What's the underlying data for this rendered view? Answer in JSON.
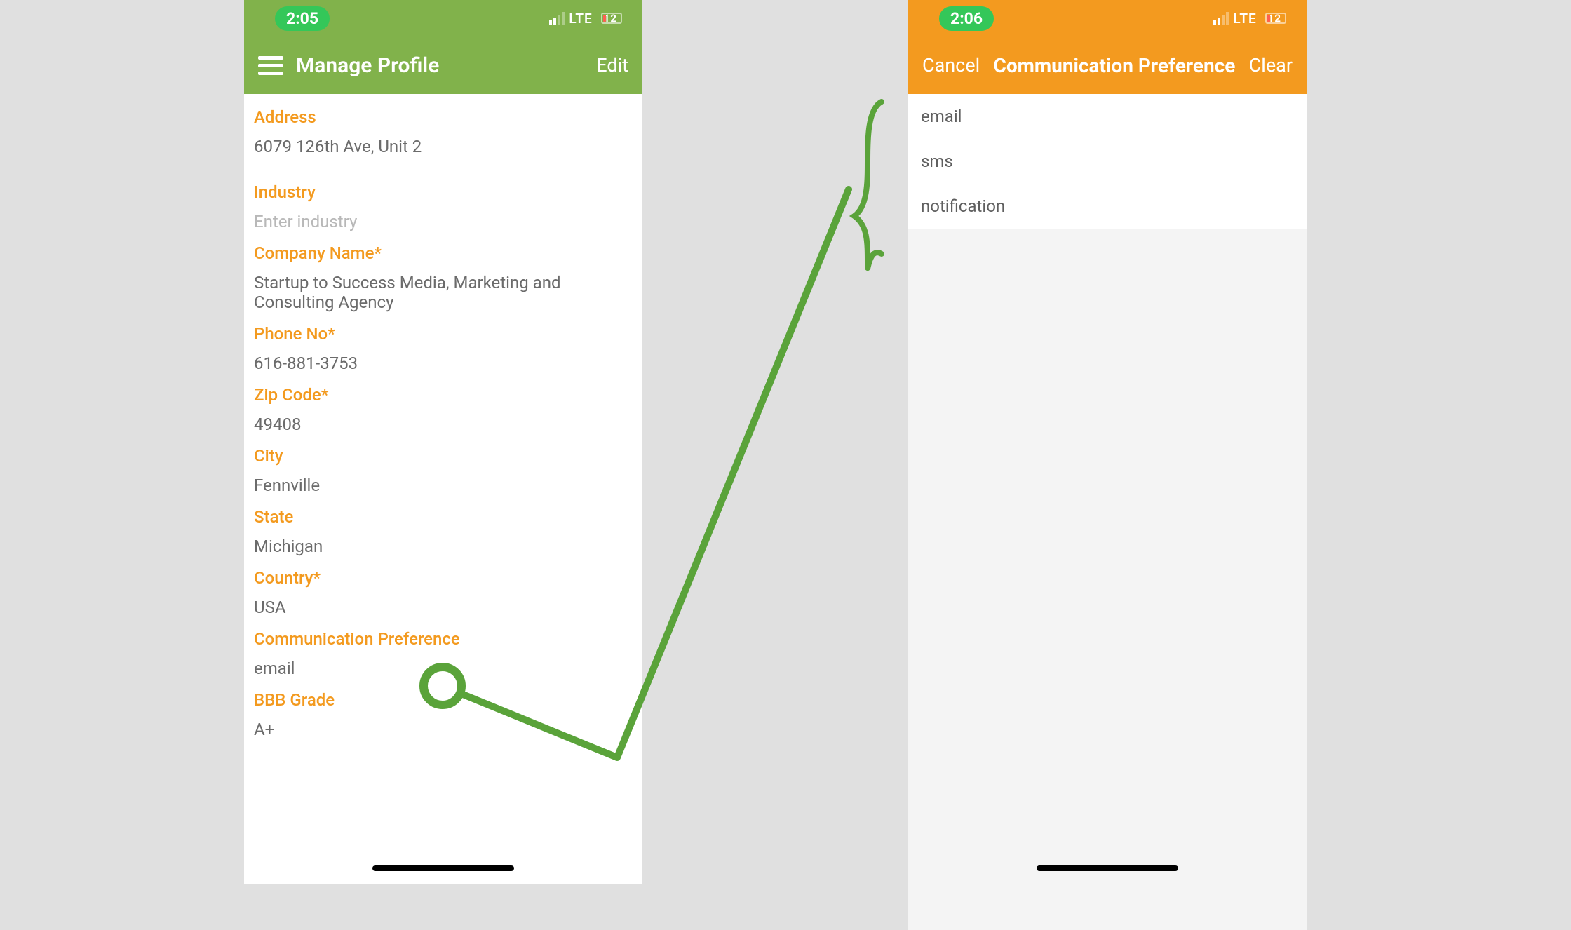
{
  "colors": {
    "green": "#81b24b",
    "orange": "#f39a1f",
    "annotation": "#5aa33a"
  },
  "left": {
    "status_time": "2:05",
    "status_net": "LTE",
    "status_batt": "12",
    "nav_title": "Manage Profile",
    "nav_action": "Edit",
    "fields": {
      "address_label": "Address",
      "address_value": "6079 126th Ave, Unit 2",
      "industry_label": "Industry",
      "industry_placeholder": "Enter industry",
      "company_label": "Company Name*",
      "company_value": "Startup to Success Media, Marketing and Consulting Agency",
      "phone_label": "Phone No*",
      "phone_value": "616-881-3753",
      "zip_label": "Zip Code*",
      "zip_value": "49408",
      "city_label": "City",
      "city_value": "Fennville",
      "state_label": "State",
      "state_value": "Michigan",
      "country_label": "Country*",
      "country_value": "USA",
      "commpref_label": "Communication Preference",
      "commpref_value": "email",
      "bbb_label": "BBB Grade",
      "bbb_value": "A+"
    }
  },
  "right": {
    "status_time": "2:06",
    "status_net": "LTE",
    "status_batt": "12",
    "nav_cancel": "Cancel",
    "nav_title": "Communication Preference",
    "nav_clear": "Clear",
    "options": {
      "opt1": "email",
      "opt2": "sms",
      "opt3": "notification"
    }
  }
}
